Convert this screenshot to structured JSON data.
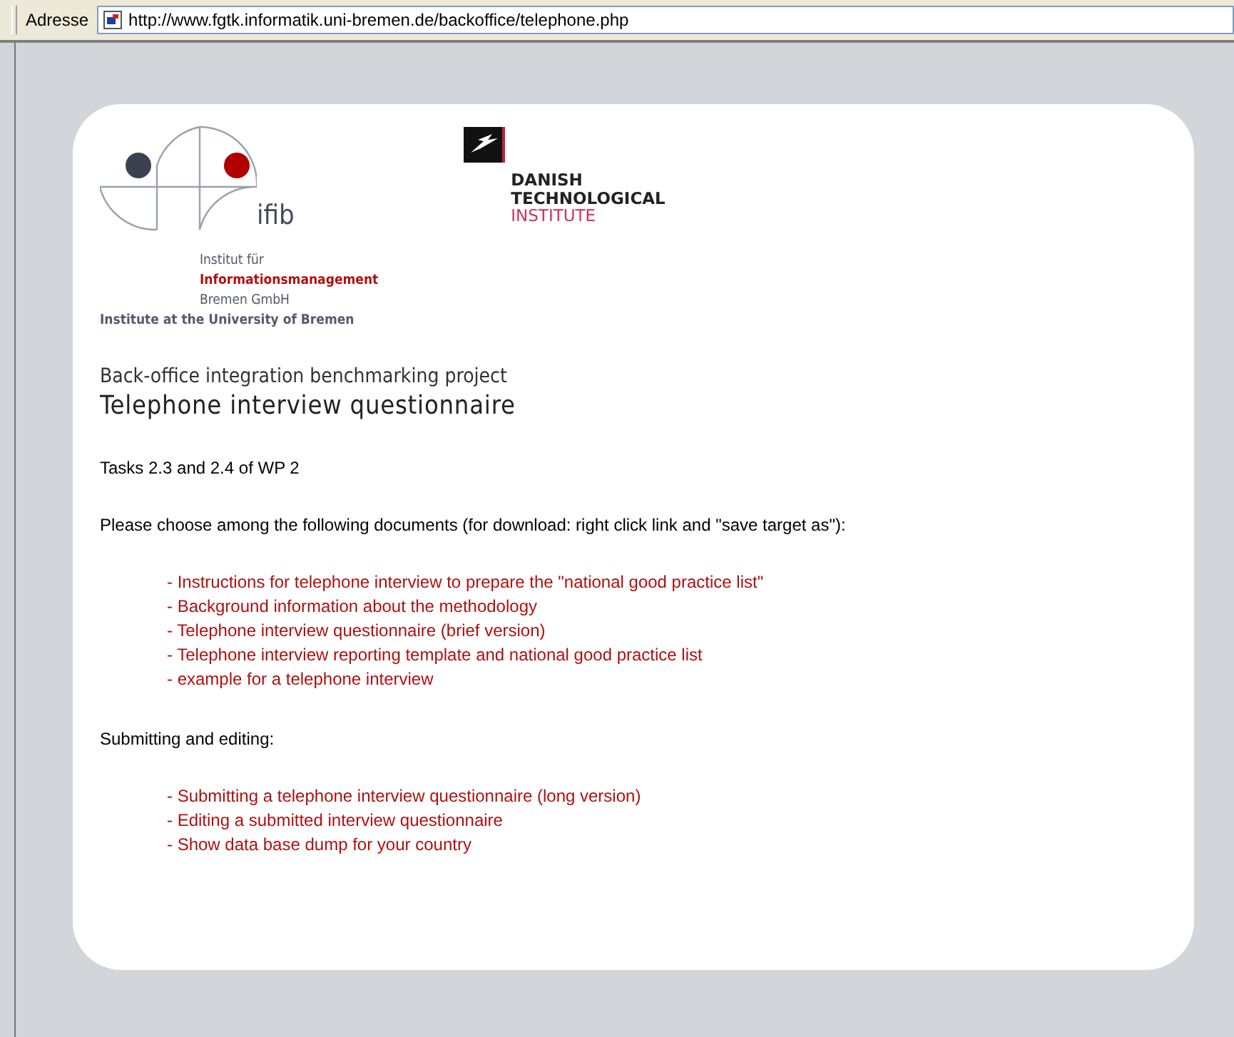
{
  "address_bar": {
    "label": "Adresse",
    "url": "http://www.fgtk.informatik.uni-bremen.de/backoffice/telephone.php"
  },
  "logos": {
    "ifib": {
      "name": "ifib",
      "lines": [
        "Institut für",
        "Informationsmanagement",
        "Bremen GmbH"
      ],
      "tagline": "Institute at the University of Bremen"
    },
    "dti": {
      "lines": [
        "DANISH",
        "TECHNOLOGICAL",
        "INSTITUTE"
      ]
    }
  },
  "heading": {
    "project": "Back-office integration benchmarking project",
    "title": "Telephone interview questionnaire"
  },
  "tasks": "Tasks 2.3 and 2.4 of WP 2",
  "documents_intro": "Please choose among the following documents (for download: right click link and \"save target as\"):",
  "documents": [
    {
      "label": "- Instructions for telephone interview to prepare the \"national good practice list\""
    },
    {
      "label": "- Background information about the methodology"
    },
    {
      "label": "- Telephone interview questionnaire (brief version)"
    },
    {
      "label": "- Telephone interview reporting template and national good practice list"
    },
    {
      "label": "- example for a telephone interview"
    }
  ],
  "submitting_intro": "Submitting and editing:",
  "submitting": [
    {
      "label": "- Submitting a telephone interview questionnaire (long version)"
    },
    {
      "label": "- Editing a submitted interview questionnaire"
    },
    {
      "label": "- Show data base dump for your country"
    }
  ]
}
